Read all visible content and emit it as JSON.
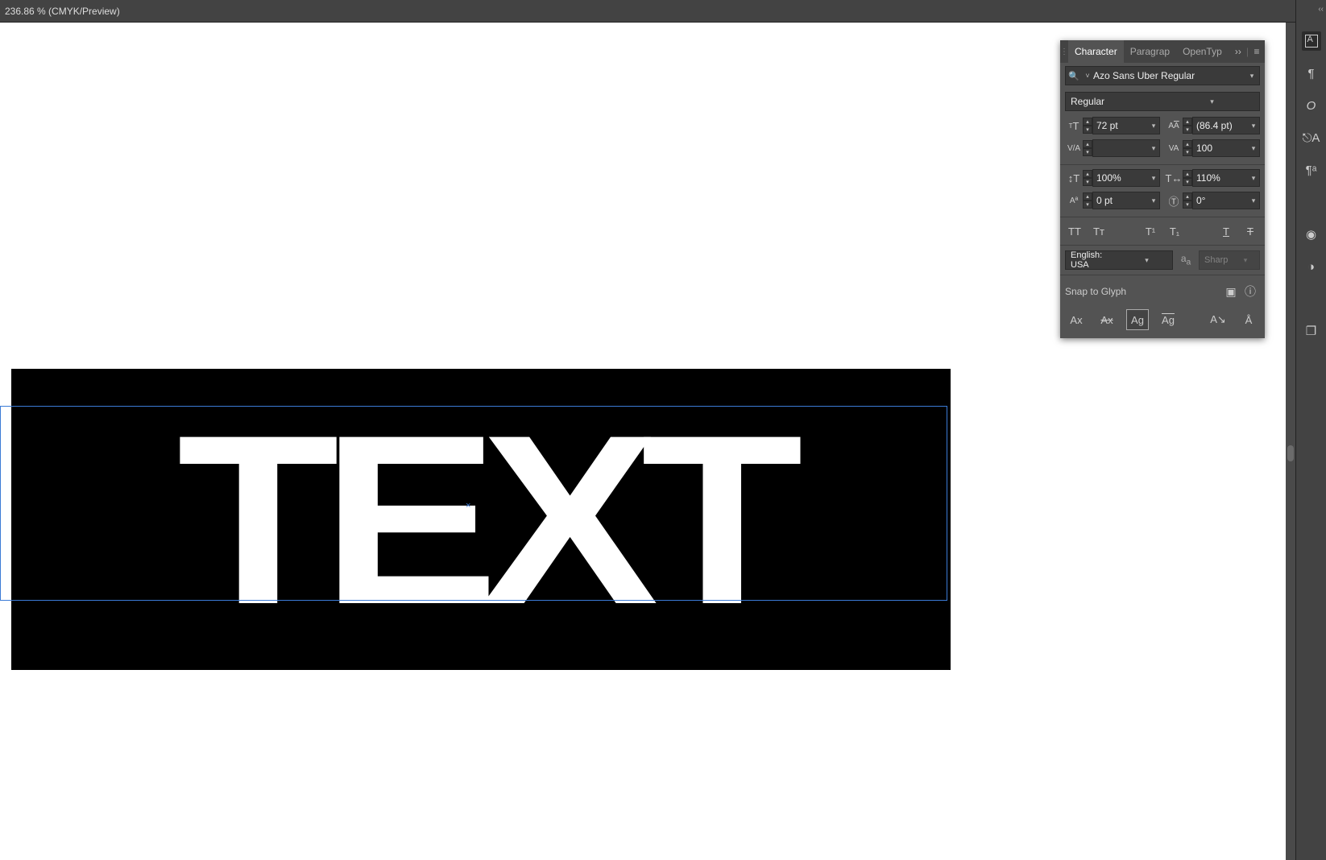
{
  "document_tab": "236.86 % (CMYK/Preview)",
  "artwork_text": "TEXT",
  "panel": {
    "tabs": {
      "character": "Character",
      "paragraph": "Paragrap",
      "opentype": "OpenTyp"
    },
    "active_tab": "character",
    "font_family": "Azo Sans Uber Regular",
    "font_style": "Regular",
    "font_size": "72 pt",
    "leading": "(86.4 pt)",
    "kerning": "",
    "tracking": "100",
    "vertical_scale": "100%",
    "horizontal_scale": "110%",
    "baseline_shift": "0 pt",
    "rotation": "0°",
    "language": "English: USA",
    "antialias": "Sharp",
    "snap_label": "Snap to Glyph"
  },
  "strip_icons": [
    "character-panel",
    "paragraph-panel",
    "opentype-panel",
    "glyphs-panel",
    "story-panel",
    "appearance-panel",
    "graphic-styles-panel",
    "artboards-panel"
  ]
}
